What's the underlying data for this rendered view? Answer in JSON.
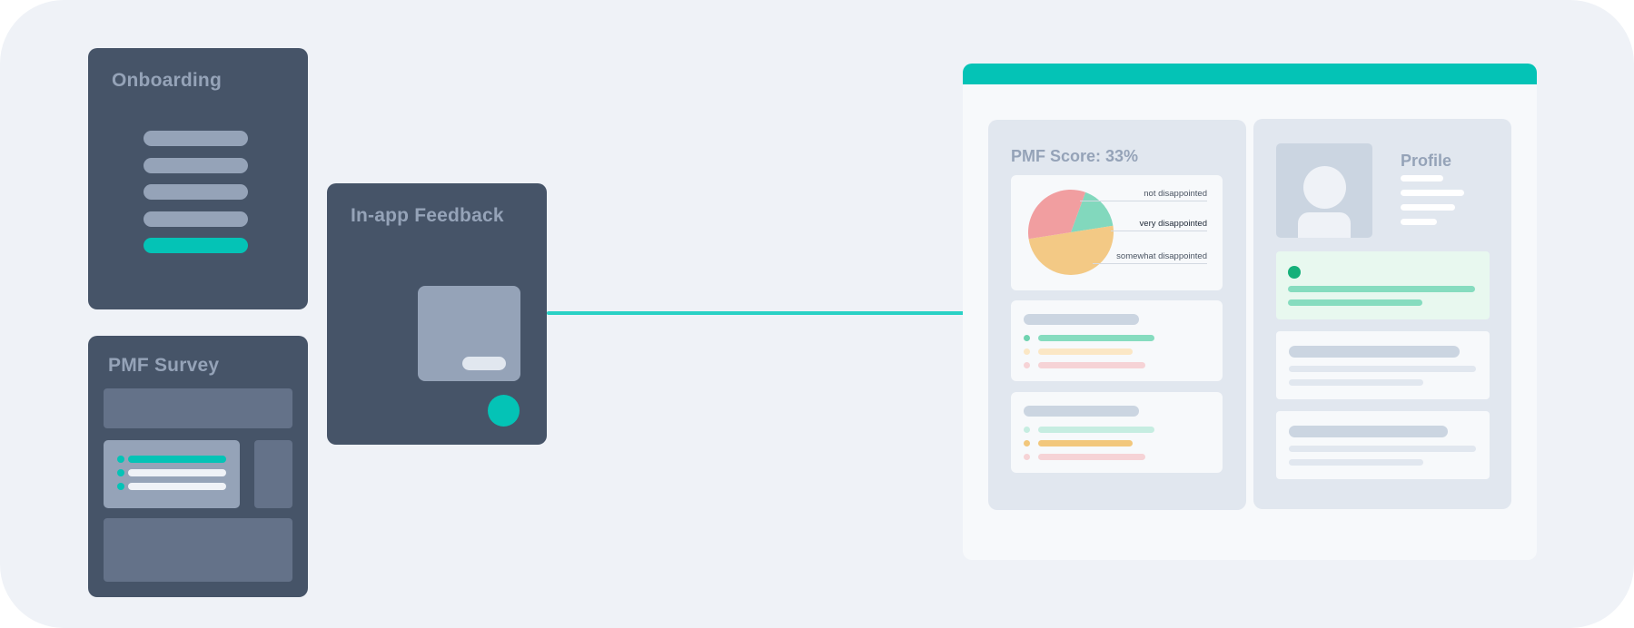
{
  "colors": {
    "background": "#eff2f7",
    "card": "#465468",
    "card_title": "#95a3b8",
    "accent": "#04c3b6",
    "connector": "#2ad1c5",
    "window_bg": "#f7f9fb",
    "panel_bg": "#e1e7ef",
    "highlight_bg": "#e8f8ef",
    "pie_not": "#82d8bd",
    "pie_very": "#f19ea0",
    "pie_somewhat": "#f3c985"
  },
  "onboarding": {
    "title": "Onboarding"
  },
  "pmf_survey": {
    "title": "PMF Survey"
  },
  "feedback": {
    "title": "In-app Feedback"
  },
  "dashboard": {
    "score_title": "PMF Score: 33%",
    "pie_legend": [
      "not disappointed",
      "very disappointed",
      "somewhat disappointed"
    ],
    "profile_title": "Profile"
  },
  "chart_data": {
    "type": "pie",
    "title": "PMF Score: 33%",
    "labels": [
      "not disappointed",
      "very disappointed",
      "somewhat disappointed"
    ],
    "values": [
      17,
      33,
      50
    ],
    "colors": [
      "#82d8bd",
      "#f19ea0",
      "#f3c985"
    ]
  }
}
